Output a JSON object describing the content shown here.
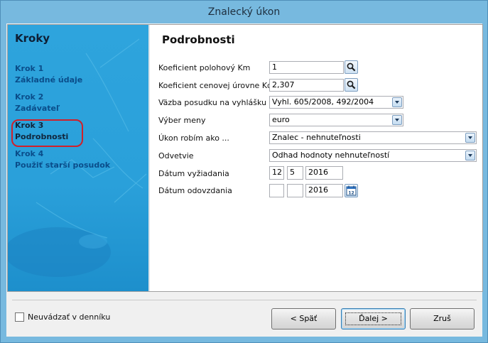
{
  "window": {
    "title": "Znalecký úkon"
  },
  "steps": {
    "title": "Kroky",
    "items": [
      {
        "num": "Krok 1",
        "label": "Základné údaje",
        "active": false
      },
      {
        "num": "Krok 2",
        "label": "Zadávateľ",
        "active": false
      },
      {
        "num": "Krok 3",
        "label": "Podrobnosti",
        "active": true
      },
      {
        "num": "Krok 4",
        "label": "Použiť starší posudok",
        "active": false
      }
    ]
  },
  "details": {
    "title": "Podrobnosti",
    "fields": {
      "km": {
        "label": "Koeficient polohový Km",
        "value": "1"
      },
      "kcu": {
        "label": "Koeficient cenovej úrovne Kcu",
        "value": "2,307"
      },
      "vyhlaska": {
        "label": "Väzba posudku na vyhlášku",
        "value": "Vyhl. 605/2008, 492/2004"
      },
      "mena": {
        "label": "Výber meny",
        "value": "euro"
      },
      "ukon": {
        "label": "Úkon robím ako ...",
        "value": "Znalec - nehnuteľnosti"
      },
      "odvetvie": {
        "label": "Odvetvie",
        "value": "Odhad hodnoty nehnuteľností"
      },
      "vyziadania": {
        "label": "Dátum vyžiadania",
        "day": "12",
        "month": "5",
        "year": "2016"
      },
      "odovzdania": {
        "label": "Dátum odovzdania",
        "day": "",
        "month": "",
        "year": "2016"
      }
    }
  },
  "footer": {
    "checkbox_label": "Neuvádzať v denníku",
    "checkbox_checked": false,
    "back_label": "< Späť",
    "next_label": "Ďalej >",
    "cancel_label": "Zruš"
  },
  "colors": {
    "title_bar": "#77b9df",
    "steps_panel": "#2ea4dd",
    "active_step_ring": "#d0202a"
  }
}
